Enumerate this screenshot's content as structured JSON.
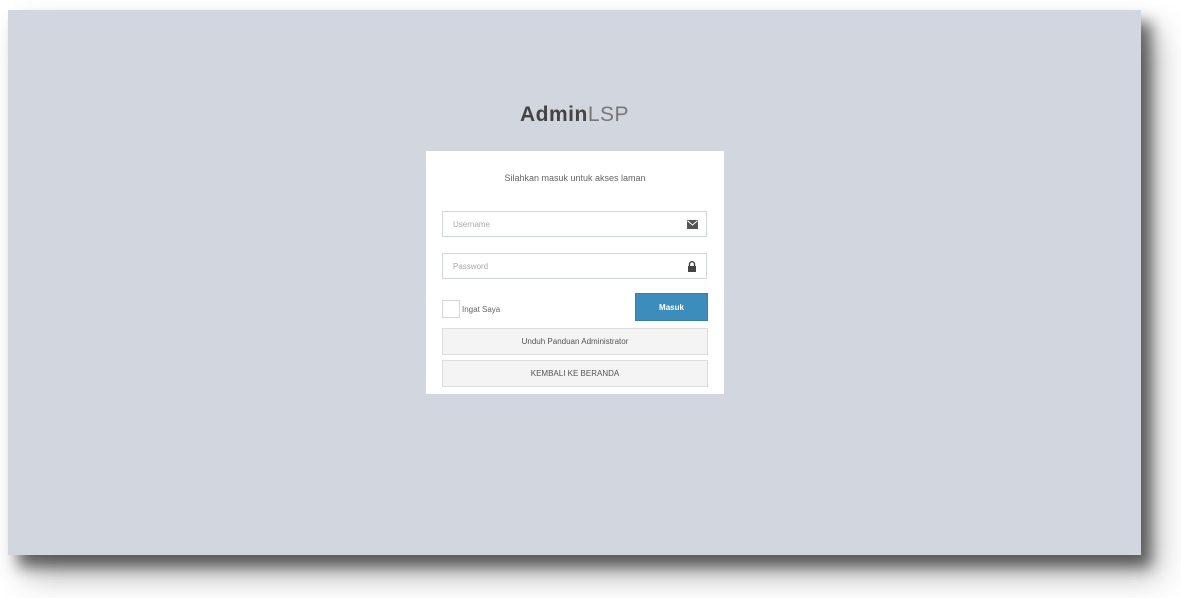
{
  "logo": {
    "bold": "Admin",
    "light": "LSP"
  },
  "login": {
    "message": "Silahkan masuk untuk akses laman",
    "username_placeholder": "Username",
    "password_placeholder": "Password",
    "remember_label": "Ingat Saya",
    "submit_label": "Masuk",
    "download_guide_label": "Unduh Panduan Administrator",
    "back_home_label": "KEMBALI KE BERANDA"
  },
  "icons": {
    "username": "envelope-icon",
    "password": "lock-icon"
  },
  "colors": {
    "background": "#d2d6de",
    "primary": "#3c8dbc",
    "box": "#ffffff"
  }
}
